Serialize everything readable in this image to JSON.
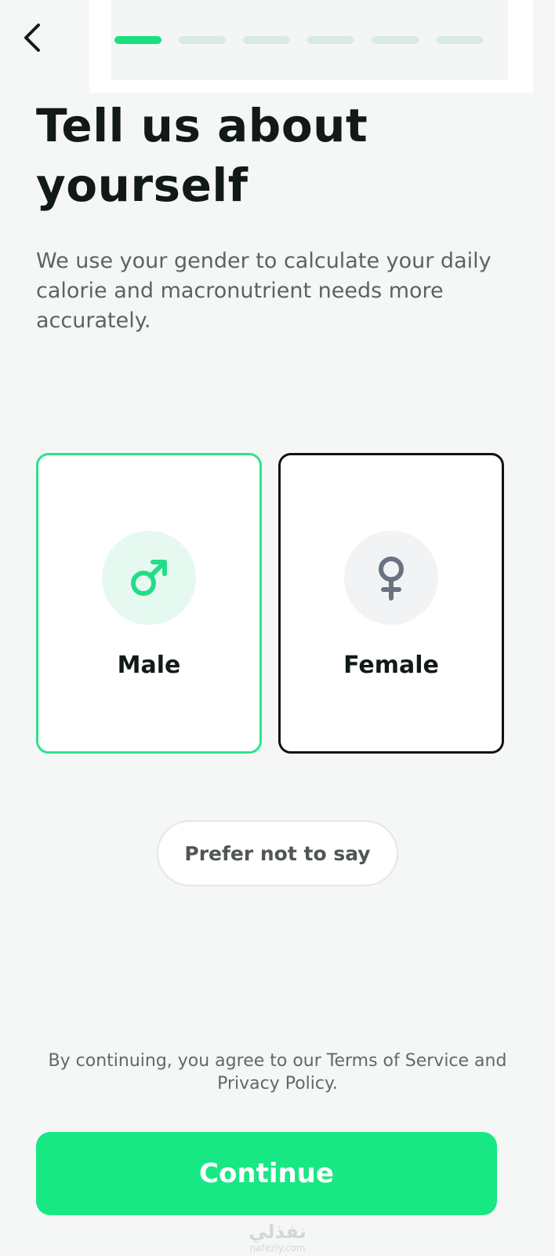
{
  "header": {
    "back_icon": "chevron-left-icon",
    "progress": {
      "total_steps": 6,
      "current_step": 1
    },
    "colors": {
      "active": "#18e07f",
      "inactive": "#d7ebe2"
    }
  },
  "main": {
    "title": "Tell us about yourself",
    "subtitle": "We use your gender to calculate your daily calorie and macronutrient needs more accurately.",
    "options": [
      {
        "label": "Male",
        "icon": "male-symbol-icon",
        "selected": true,
        "accent": "#2fe28c"
      },
      {
        "label": "Female",
        "icon": "female-symbol-icon",
        "selected": false,
        "accent": "#6b7280"
      }
    ],
    "prefer_not_label": "Prefer not to say"
  },
  "footer": {
    "legal_text": "By continuing, you agree to our Terms of Service and Privacy Policy.",
    "continue_label": "Continue",
    "continue_color": "#18e884"
  },
  "watermark": {
    "arabic": "نفذلي",
    "latin": "nafezly.com"
  }
}
